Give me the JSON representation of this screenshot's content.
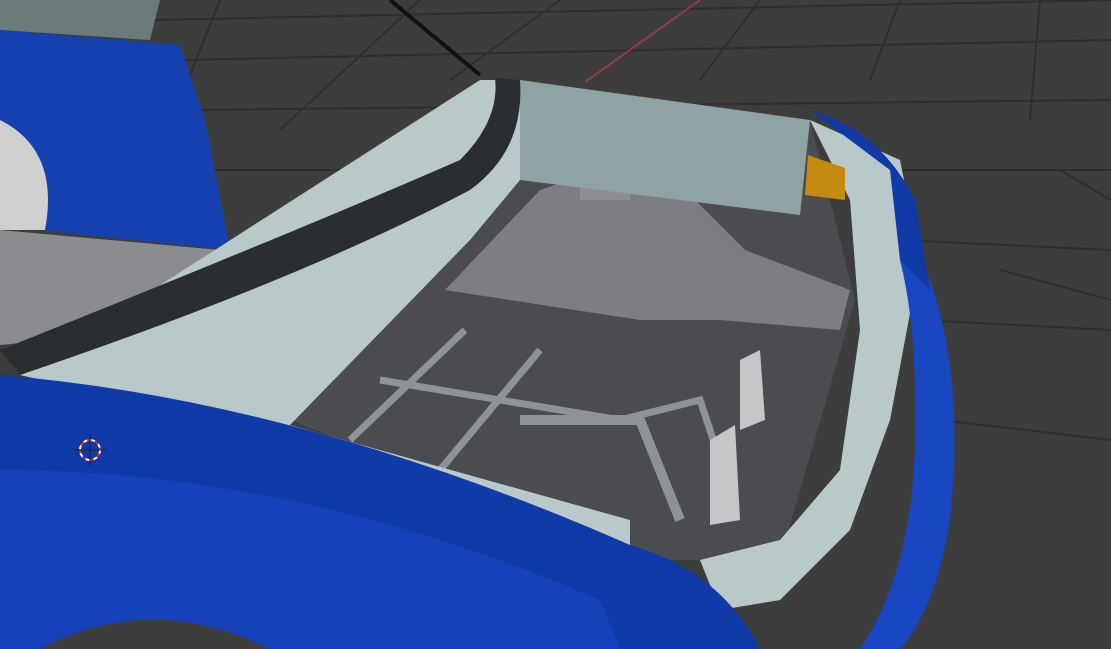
{
  "viewport": {
    "background": "#3d3d3d",
    "grid_color": "#2e2e2e",
    "x_axis_color": "#a83a44",
    "model": {
      "body_color": "#0f3aa8",
      "panel_color": "#b9c9ca",
      "interior_color": "#5a5c60",
      "trim_color": "#2b2e30",
      "accent_color": "#c58a10"
    },
    "cursor_icon": "3d-cursor-icon"
  }
}
